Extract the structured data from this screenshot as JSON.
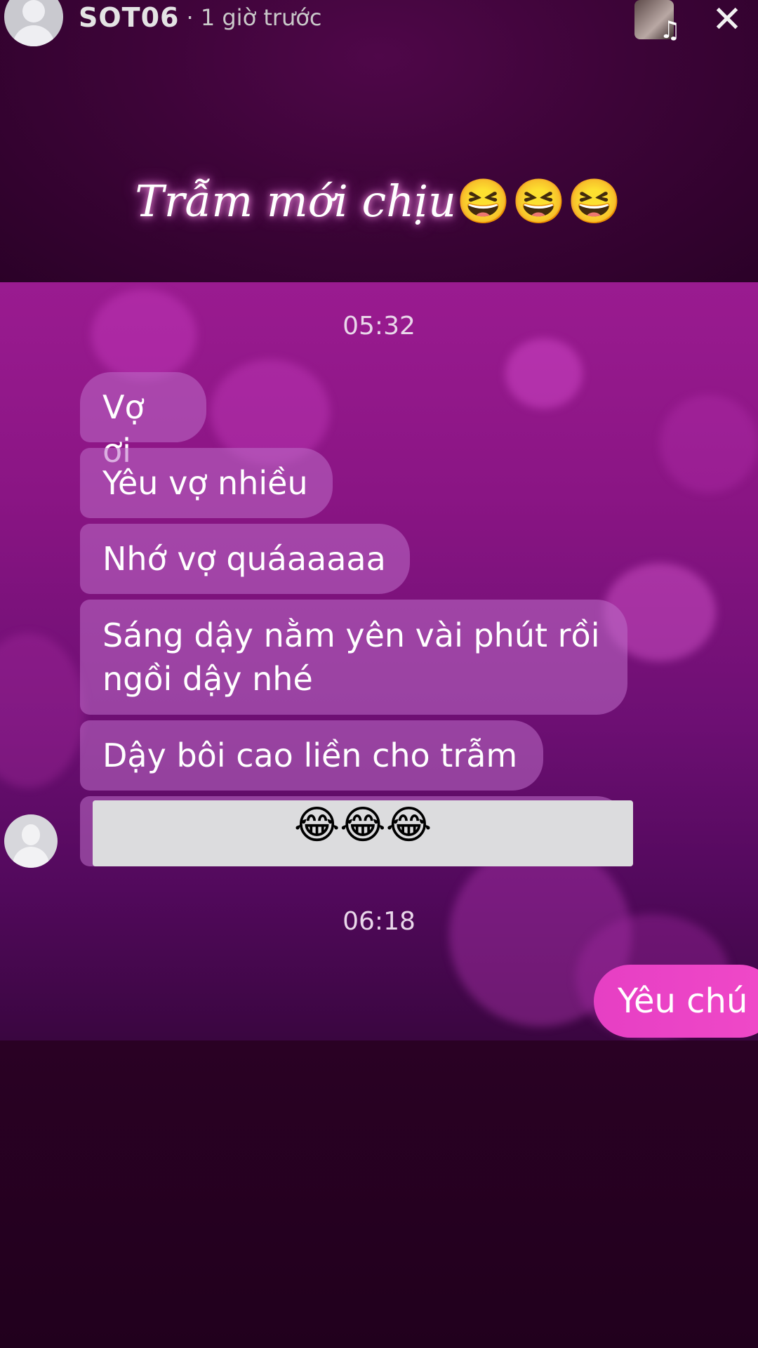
{
  "header": {
    "username": "SOT06",
    "time_ago": "· 1 giờ trước",
    "avatar_icon": "default-avatar-icon",
    "music_icon": "music-note-icon",
    "close_icon": "close-icon"
  },
  "caption": {
    "text": "Trẫm mới chịu",
    "emojis": "😆😆😆"
  },
  "chat": {
    "timestamps": [
      "05:32",
      "06:18"
    ],
    "incoming": [
      {
        "text": "Vợ ơi"
      },
      {
        "text": "Yêu vợ nhiều"
      },
      {
        "text": "Nhớ vợ quáaaaaa"
      },
      {
        "text": "Sáng dậy nằm yên vài phút rồi ngồi dậy nhé"
      },
      {
        "text": "Dậy bôi cao liền cho trẫm"
      }
    ],
    "redacted_emojis": "😂😂😂",
    "outgoing": [
      {
        "text": "Yêu chú"
      }
    ]
  },
  "colors": {
    "outgoing_bubble": "#ee46c7",
    "incoming_bubble": "#b46ec8",
    "chat_background": "#8a1584",
    "page_background": "#2a0125"
  }
}
